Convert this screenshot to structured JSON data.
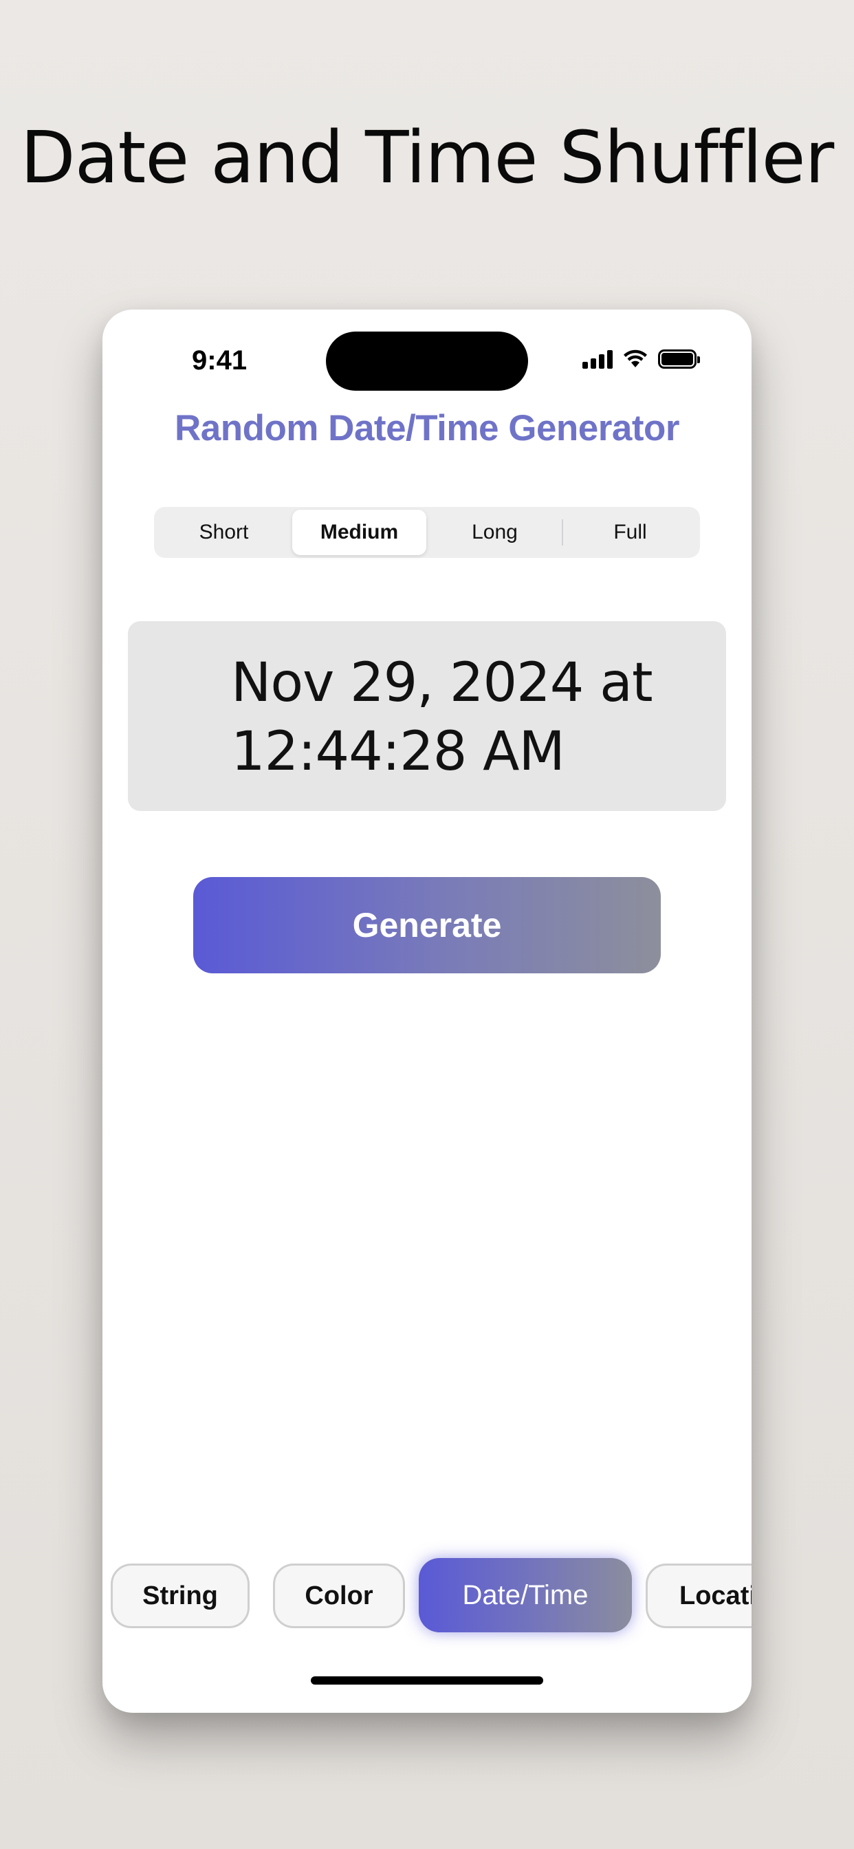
{
  "headline": "Date and Time Shuffler",
  "status_bar": {
    "time": "9:41"
  },
  "app": {
    "title": "Random Date/Time Generator",
    "title_color": "#6f73c8"
  },
  "format_segments": {
    "options": [
      "Short",
      "Medium",
      "Long",
      "Full"
    ],
    "selected": "Medium"
  },
  "result": {
    "line1": "Nov 29, 2024 at",
    "line2": "12:44:28 AM"
  },
  "generate_button": {
    "label": "Generate",
    "gradient_start": "#5a5ad6",
    "gradient_end": "#8d8f9c"
  },
  "tabs": {
    "items": [
      "String",
      "Color",
      "Date/Time",
      "Locati"
    ],
    "active": "Date/Time"
  },
  "icons": [
    "signal-icon",
    "wifi-icon",
    "battery-icon"
  ]
}
